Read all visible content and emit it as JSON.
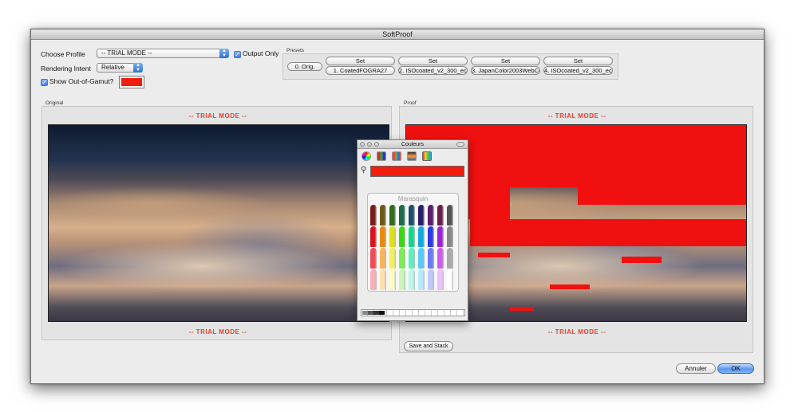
{
  "window": {
    "title": "SoftProof"
  },
  "profile": {
    "label": "Choose Profile",
    "value": "-- TRIAL MODE --",
    "output_only_label": "Output Only"
  },
  "rendering": {
    "label": "Rendering Intent",
    "value": "Relative"
  },
  "gamut": {
    "label": "Show Out-of-Gamut?",
    "swatch_color": "#f21d0c"
  },
  "presets": {
    "label": "Presets",
    "orig_label": "0. Orig.",
    "set_label": "Set",
    "items": [
      "1. CoatedFOGRA27",
      "2. ISOcoated_v2_300_eci",
      "3. JapanColor2003WebCo",
      "4. ISOcoated_v2_300_eci"
    ]
  },
  "original": {
    "label": "Original",
    "trial_top": "-- TRIAL MODE --",
    "trial_bottom": "-- TRIAL MODE --"
  },
  "proof": {
    "label": "Proof",
    "trial_top": "-- TRIAL MODE --",
    "trial_bottom": "-- TRIAL MODE --",
    "save_label": "Save and Stack",
    "gamut_color": "#f11010"
  },
  "colors_panel": {
    "title": "Couleurs",
    "selected_color": "#f21d0c",
    "crayon_name": "Marasquin"
  },
  "buttons": {
    "cancel": "Annuler",
    "ok": "OK"
  }
}
